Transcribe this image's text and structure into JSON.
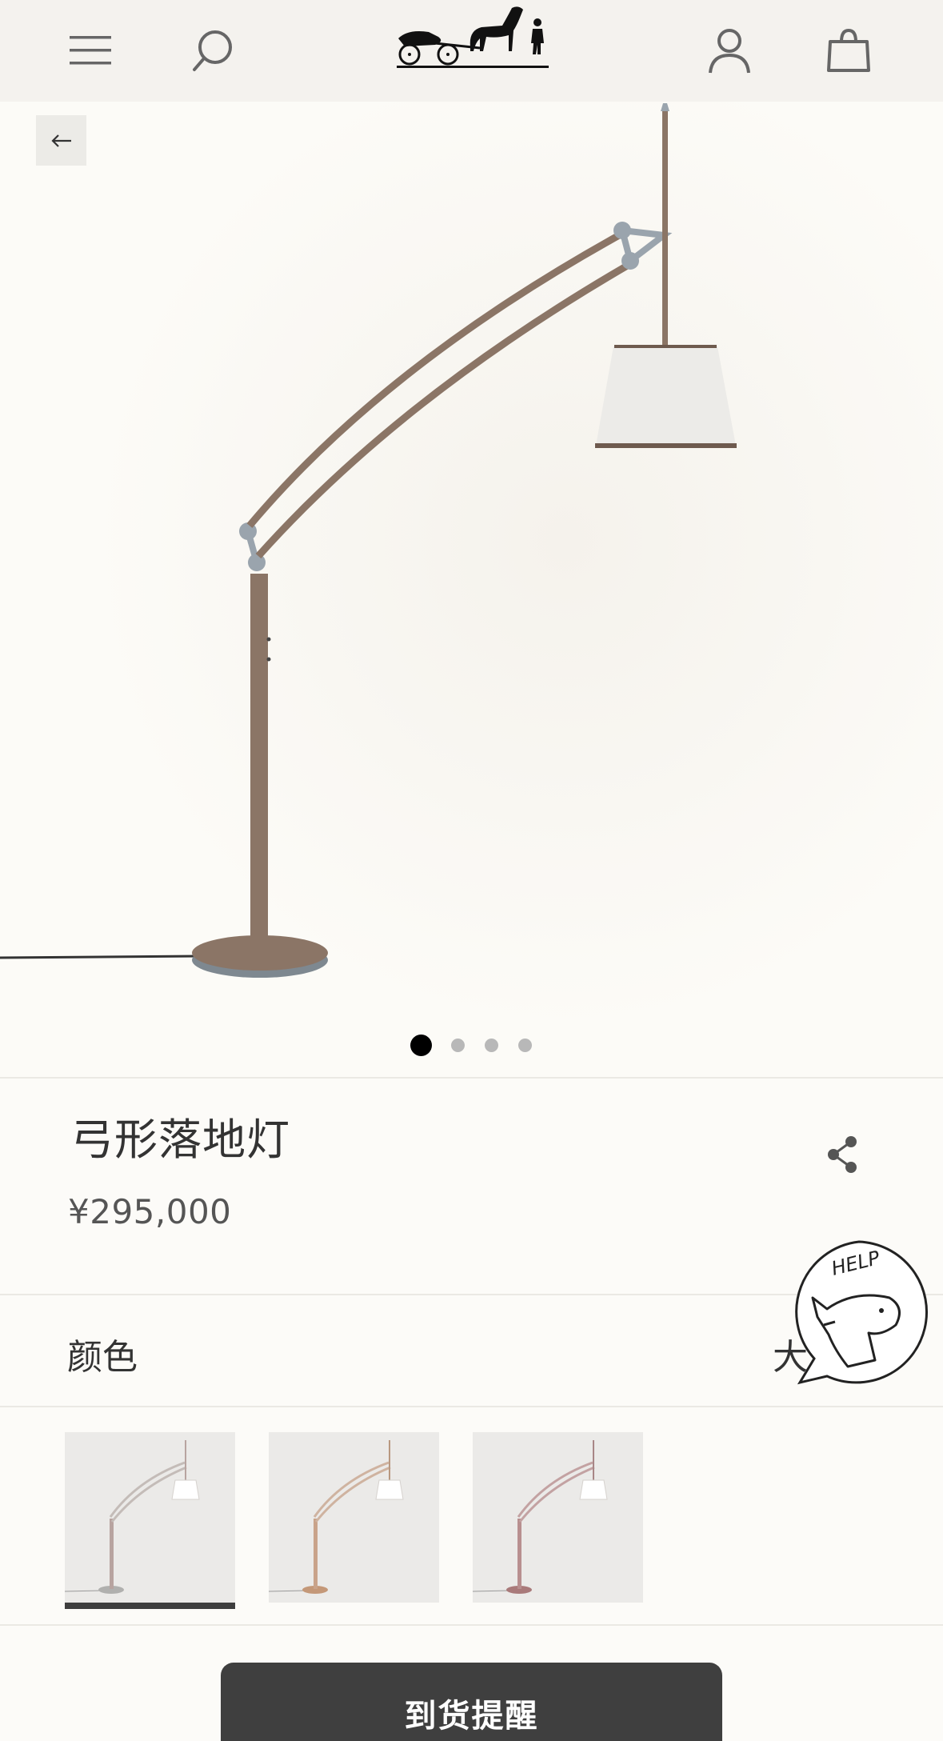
{
  "header": {
    "menu_icon": "menu-icon",
    "search_icon": "search-icon",
    "logo": "hermes-carriage-logo",
    "account_icon": "user-icon",
    "cart_icon": "shopping-bag-icon"
  },
  "gallery": {
    "back_icon": "arrow-left-icon",
    "image": "arc-floor-lamp-photo",
    "dots": 4,
    "active_dot": 0
  },
  "product": {
    "title": "弓形落地灯",
    "price": "¥295,000",
    "share_icon": "share-icon"
  },
  "color": {
    "label": "颜色",
    "selected_value": "大"
  },
  "help_widget": {
    "text": "HELP"
  },
  "swatches": [
    {
      "name": "swatch-1",
      "selected": true,
      "stem_color": "#b8a4a0",
      "base_color": "#b0b0ae"
    },
    {
      "name": "swatch-2",
      "selected": false,
      "stem_color": "#c9a38a",
      "base_color": "#c49878"
    },
    {
      "name": "swatch-3",
      "selected": false,
      "stem_color": "#b88f8f",
      "base_color": "#a97a7a"
    }
  ],
  "cta": {
    "label": "到货提醒"
  },
  "colors": {
    "header_bg": "#f4f2ee",
    "page_bg": "#fcfbf8",
    "button_bg": "#3f3f3f",
    "lamp_stem": "#8b7566"
  }
}
